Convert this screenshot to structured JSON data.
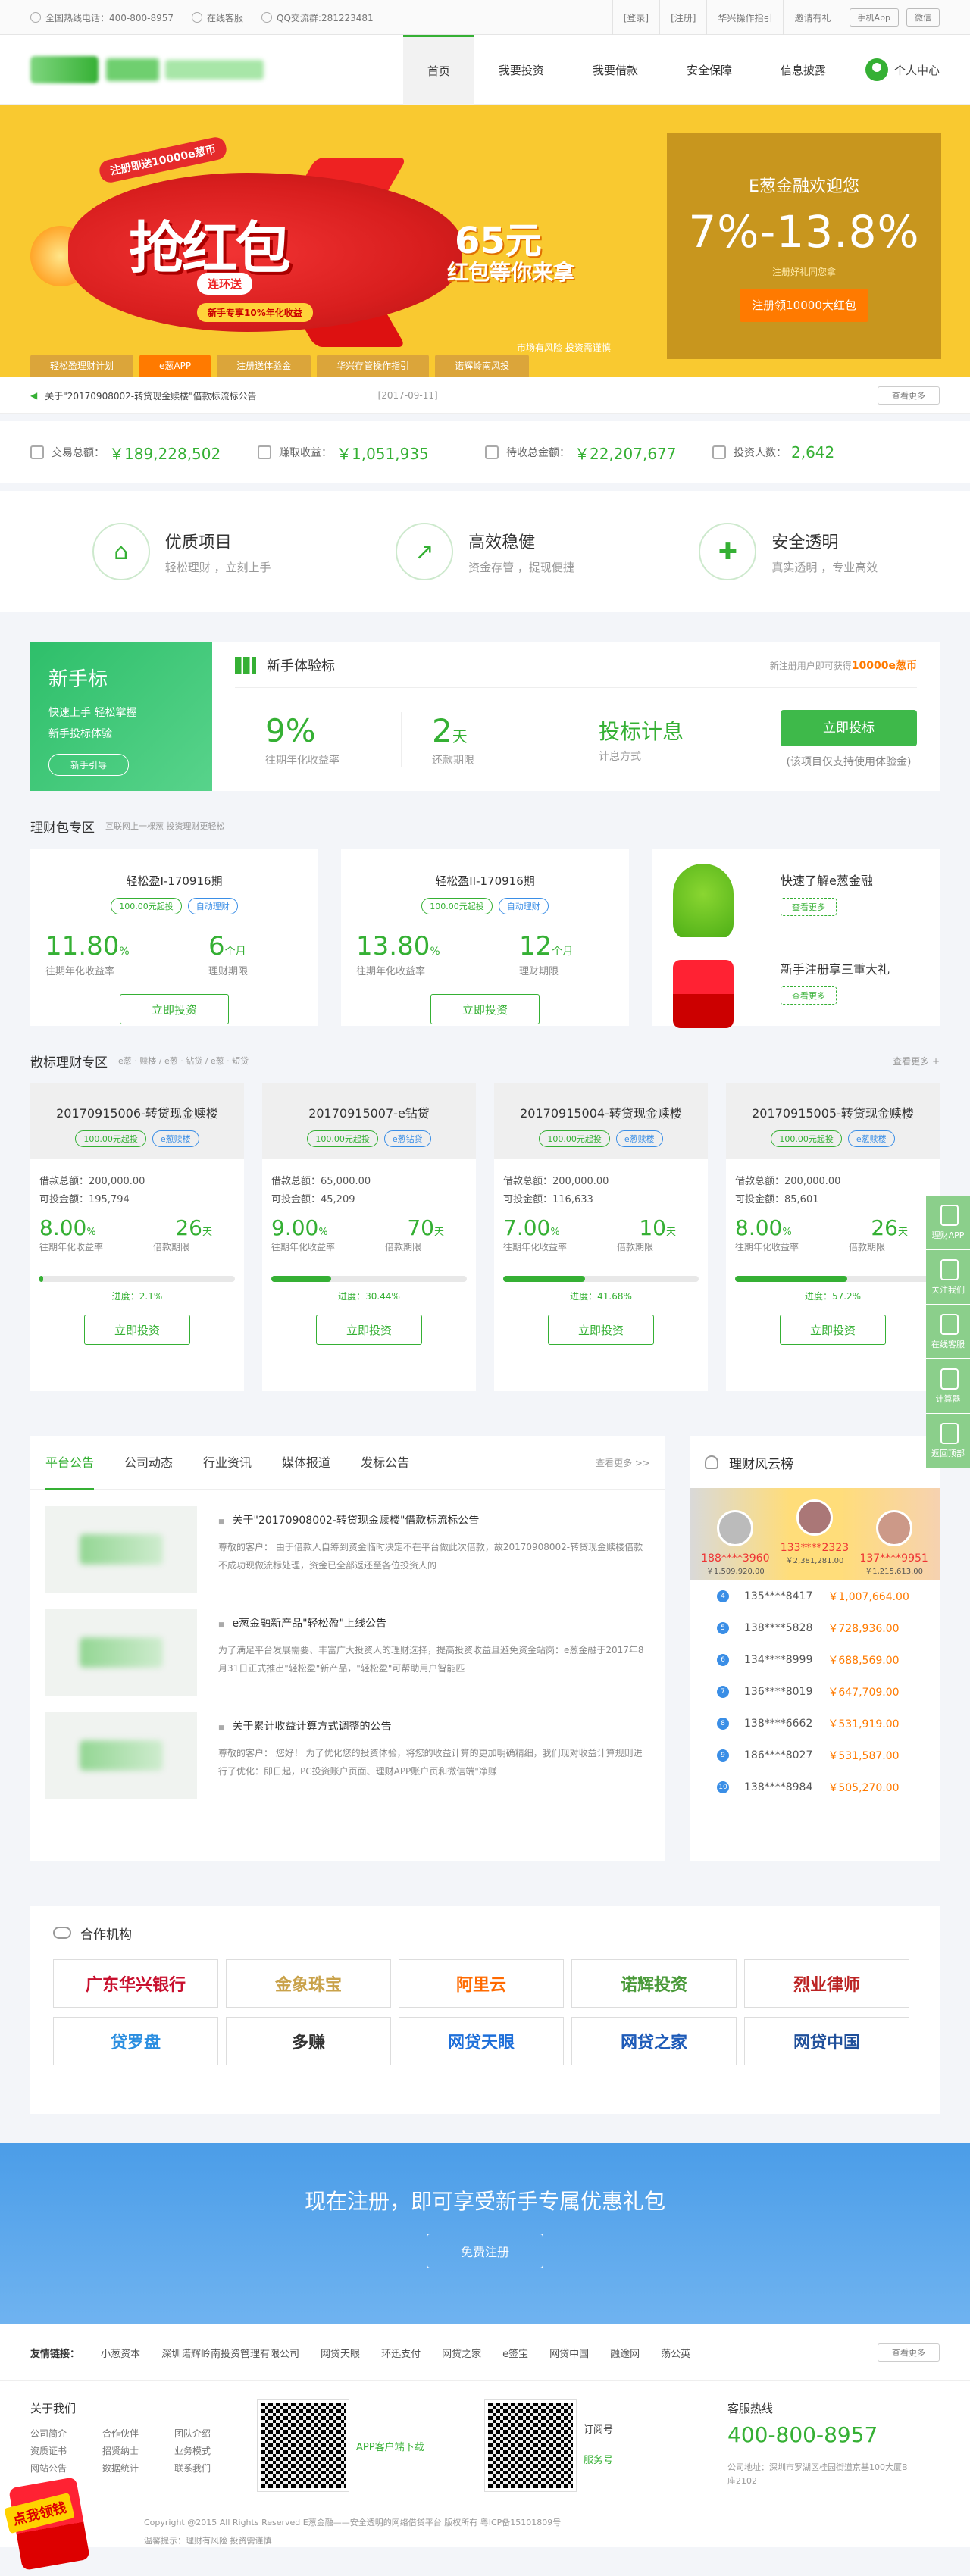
{
  "topbar": {
    "hotline": "全国热线电话：400-800-8957",
    "service": "在线客服",
    "qq": "QQ交流群:281223481",
    "login": "[登录]",
    "register": "[注册]",
    "guide": "华兴操作指引",
    "invite": "邀请有礼",
    "app": "手机App",
    "wechat": "微信"
  },
  "nav": {
    "items": [
      "首页",
      "我要投资",
      "我要借款",
      "安全保障",
      "信息披露"
    ],
    "user": "个人中心"
  },
  "banner": {
    "ribbon": "注册即送10000e葱币",
    "main": "抢红包",
    "sub": "连环送",
    "sub2": "新手专享10%年化收益",
    "amt": "65元",
    "amt_sub": "红包等你来拿",
    "welcome": "E葱金融欢迎您",
    "rate": "7%-13.8%",
    "tip": "注册好礼同您拿",
    "btn": "注册领10000大红包",
    "note": "市场有风险 投资需谨慎",
    "tabs": [
      "轻松盈理财计划",
      "e葱APP",
      "注册送体验金",
      "华兴存管操作指引",
      "诺辉岭南风投"
    ]
  },
  "notice": {
    "text": "关于\"20170908002-转贷现金赎楼\"借款标流标公告",
    "date": "[2017-09-11]",
    "more": "查看更多"
  },
  "stats": [
    {
      "label": "交易总额：",
      "value": "￥189,228,502"
    },
    {
      "label": "赚取收益：",
      "value": "￥1,051,935"
    },
    {
      "label": "待收总金额：",
      "value": "￥22,207,677"
    },
    {
      "label": "投资人数：",
      "value": "2,642"
    }
  ],
  "features": [
    {
      "title": "优质项目",
      "sub": "轻松理财 ，立刻上手",
      "icon": "building-icon"
    },
    {
      "title": "高效稳健",
      "sub": "资金存管 ，提现便捷",
      "icon": "chart-icon"
    },
    {
      "title": "安全透明",
      "sub": "真实透明 ，专业高效",
      "icon": "shield-icon"
    }
  ],
  "newbie": {
    "title": "新手标",
    "line1": "快速上手 轻松掌握",
    "line2": "新手投标体验",
    "guide": "新手引导",
    "head": "新手体验标",
    "head_note": "新注册用户即可获得",
    "head_bonus": "10000e葱币",
    "rate": "9%",
    "rate_l": "往期年化收益率",
    "days": "2",
    "days_unit": "天",
    "days_l": "还款期限",
    "method": "投标计息",
    "method_l": "计息方式",
    "invest": "立即投标",
    "invest_note": "(该项目仅支持使用体验金)"
  },
  "pkg": {
    "title": "理财包专区",
    "sub": "互联网上一棵葱 投资理财更轻松",
    "cards": [
      {
        "name": "轻松盈I-170916期",
        "tags": [
          "100.00元起投",
          "自动理财"
        ],
        "rate": "11.80",
        "rate_unit": "%",
        "rate_l": "往期年化收益率",
        "term": "6",
        "term_unit": "个月",
        "term_l": "理财期限",
        "btn": "立即投资"
      },
      {
        "name": "轻松盈II-170916期",
        "tags": [
          "100.00元起投",
          "自动理财"
        ],
        "rate": "13.80",
        "rate_unit": "%",
        "rate_l": "往期年化收益率",
        "term": "12",
        "term_unit": "个月",
        "term_l": "理财期限",
        "btn": "立即投资"
      }
    ],
    "ads": [
      {
        "title": "快速了解e葱金融",
        "btn": "查看更多"
      },
      {
        "title": "新手注册享三重大礼",
        "btn": "查看更多"
      }
    ]
  },
  "loans": {
    "title": "散标理财专区",
    "sub": "e葱 · 赎楼 / e葱 · 钻贷 / e葱 · 短贷",
    "more": "查看更多 +",
    "cards": [
      {
        "name": "20170915006-转贷现金赎楼",
        "tags": [
          "100.00元起投",
          "e葱赎楼"
        ],
        "total": "借款总额：200,000.00",
        "avail": "可投金额：195,794",
        "rate": "8.00",
        "rate_l": "往期年化收益率",
        "term": "26",
        "term_unit": "天",
        "term_l": "借款期限",
        "progress": 2.1,
        "pct": "进度：2.1%",
        "btn": "立即投资"
      },
      {
        "name": "20170915007-e钻贷",
        "tags": [
          "100.00元起投",
          "e葱钻贷"
        ],
        "total": "借款总额：65,000.00",
        "avail": "可投金额：45,209",
        "rate": "9.00",
        "rate_l": "往期年化收益率",
        "term": "70",
        "term_unit": "天",
        "term_l": "借款期限",
        "progress": 30.44,
        "pct": "进度：30.44%",
        "btn": "立即投资"
      },
      {
        "name": "20170915004-转贷现金赎楼",
        "tags": [
          "100.00元起投",
          "e葱赎楼"
        ],
        "total": "借款总额：200,000.00",
        "avail": "可投金额：116,633",
        "rate": "7.00",
        "rate_l": "往期年化收益率",
        "term": "10",
        "term_unit": "天",
        "term_l": "借款期限",
        "progress": 41.68,
        "pct": "进度：41.68%",
        "btn": "立即投资"
      },
      {
        "name": "20170915005-转贷现金赎楼",
        "tags": [
          "100.00元起投",
          "e葱赎楼"
        ],
        "total": "借款总额：200,000.00",
        "avail": "可投金额：85,601",
        "rate": "8.00",
        "rate_l": "往期年化收益率",
        "term": "26",
        "term_unit": "天",
        "term_l": "借款期限",
        "progress": 57.2,
        "pct": "进度：57.2%",
        "btn": "立即投资"
      }
    ]
  },
  "float": [
    "理财APP",
    "关注我们",
    "在线客服",
    "计算器",
    "返回顶部"
  ],
  "news": {
    "tabs": [
      "平台公告",
      "公司动态",
      "行业资讯",
      "媒体报道",
      "发标公告"
    ],
    "more": "查看更多 >>",
    "items": [
      {
        "title": "关于\"20170908002-转贷现金赎楼\"借款标流标公告",
        "desc": "尊敬的客户： 由于借款人自筹到资金临时决定不在平台做此次借款，故20170908002-转贷现金赎楼借款不成功现做流标处理，资金已全部返还至各位投资人的"
      },
      {
        "title": "e葱金融新产品\"轻松盈\"上线公告",
        "desc": "为了满足平台发展需要、丰富广大投资人的理财选择，提高投资收益且避免资金站岗：e葱金融于2017年8月31日正式推出\"轻松盈\"新产品，\"轻松盈\"可帮助用户智能匹"
      },
      {
        "title": "关于累计收益计算方式调整的公告",
        "desc": "尊敬的客户： 您好！ 为了优化您的投资体验，将您的收益计算的更加明确精细，我们现对收益计算规则进行了优化：即日起，PC投资账户页面、理财APP账户页和微信端\"净赚"
      }
    ]
  },
  "rank": {
    "title": "理财风云榜",
    "top": [
      {
        "user": "188****3960",
        "amt": "￥1,509,920.00"
      },
      {
        "user": "133****2323",
        "amt": "￥2,381,281.00"
      },
      {
        "user": "137****9951",
        "amt": "￥1,215,613.00"
      }
    ],
    "rows": [
      {
        "n": "4",
        "user": "135****8417",
        "amt": "￥1,007,664.00"
      },
      {
        "n": "5",
        "user": "138****5828",
        "amt": "￥728,936.00"
      },
      {
        "n": "6",
        "user": "134****8999",
        "amt": "￥688,569.00"
      },
      {
        "n": "7",
        "user": "136****8019",
        "amt": "￥647,709.00"
      },
      {
        "n": "8",
        "user": "138****6662",
        "amt": "￥531,919.00"
      },
      {
        "n": "9",
        "user": "186****8027",
        "amt": "￥531,587.00"
      },
      {
        "n": "10",
        "user": "138****8984",
        "amt": "￥505,270.00"
      }
    ]
  },
  "partners": {
    "title": "合作机构",
    "items": [
      {
        "name": "广东华兴银行",
        "color": "#c8102e"
      },
      {
        "name": "金象珠宝",
        "color": "#c9a24a"
      },
      {
        "name": "阿里云",
        "color": "#ff6a00"
      },
      {
        "name": "诺辉投资",
        "color": "#4a9a3a"
      },
      {
        "name": "烈业律师",
        "color": "#b22"
      },
      {
        "name": "贷罗盘",
        "color": "#2a8ee0"
      },
      {
        "name": "多赚",
        "color": "#333"
      },
      {
        "name": "网贷天眼",
        "color": "#1e6fd9"
      },
      {
        "name": "网贷之家",
        "color": "#1e5bb8"
      },
      {
        "name": "网贷中国",
        "color": "#1f4f9a"
      }
    ]
  },
  "cta": {
    "text": "现在注册，即可享受新手专属优惠礼包",
    "btn": "免费注册"
  },
  "friend": {
    "label": "友情链接：",
    "links": [
      "小葱资本",
      "深圳诺辉岭南投资管理有限公司",
      "网贷天眼",
      "环迅支付",
      "网贷之家",
      "e签宝",
      "网贷中国",
      "融途网",
      "荡公英"
    ],
    "more": "查看更多"
  },
  "footer": {
    "about": "关于我们",
    "links": [
      "公司简介",
      "合作伙伴",
      "团队介绍",
      "资质证书",
      "招贤纳士",
      "业务模式",
      "网站公告",
      "数据统计",
      "联系我们"
    ],
    "app": "APP客户端下载",
    "sub": "订阅号",
    "svc": "服务号",
    "hot": "客服热线",
    "phone": "400-800-8957",
    "addr": "公司地址：深圳市罗湖区桂园街道京基100大厦B座2102",
    "copy": "Copyright @2015 All Rights Reserved E葱金融——安全透明的网络借贷平台 版权所有 粤ICP备15101809号",
    "risk": "温馨提示：理财有风险 投资需谨慎",
    "redbag": "点我领钱"
  }
}
